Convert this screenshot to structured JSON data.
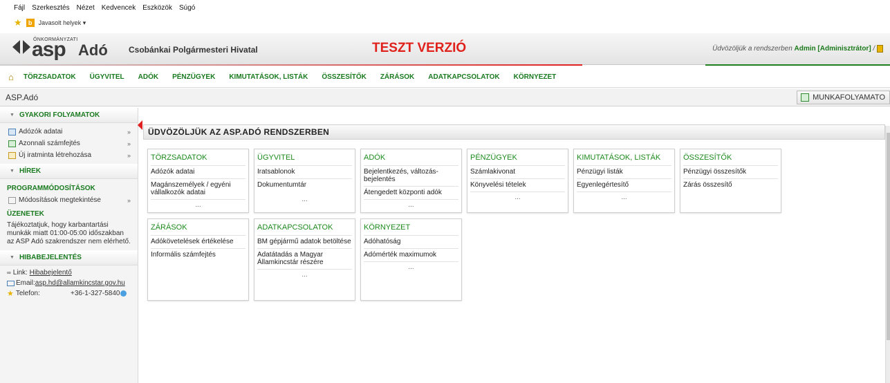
{
  "browser": {
    "menu": [
      "Fájl",
      "Szerkesztés",
      "Nézet",
      "Kedvencek",
      "Eszközök",
      "Súgó"
    ],
    "favorites_label": "Javasolt helyek ▾"
  },
  "header": {
    "logo_small": "ÖNKORMÁNYZATI",
    "logo_asp": "asp",
    "logo_ado": "Adó",
    "org_name": "Csobánkai Polgármesteri Hivatal",
    "test_banner": "TESZT VERZIÓ",
    "welcome_prefix": "Üdvözöljük a rendszerben",
    "welcome_user": "Admin [Adminisztrátor]",
    "welcome_suffix": " /"
  },
  "nav": {
    "items": [
      "TÖRZSADATOK",
      "ÜGYVITEL",
      "ADÓK",
      "PÉNZÜGYEK",
      "KIMUTATÁSOK, LISTÁK",
      "ÖSSZESÍTŐK",
      "ZÁRÁSOK",
      "ADATKAPCSOLATOK",
      "KÖRNYEZET"
    ]
  },
  "breadcrumb": "ASP.Adó",
  "workflow_button": "MUNKAFOLYAMATO",
  "sidebar": {
    "gyakori_title": "GYAKORI FOLYAMATOK",
    "gyakori_items": [
      "Adózók adatai",
      "Azonnali számfejtés",
      "Új iratminta létrehozása"
    ],
    "hirek_title": "HÍREK",
    "programmod_title": "PROGRAMMÓDOSÍTÁSOK",
    "programmod_item": "Módosítások megtekintése",
    "uzenetek_title": "ÜZENETEK",
    "uzenet_text": "Tájékoztatjuk, hogy karbantartási munkák miatt 01:00-05:00 időszakban az ASP Adó szakrendszer nem elérhető.",
    "hiba_title": "HIBABEJELENTÉS",
    "link_label": "Link:",
    "link_value": "Hibabejelentő",
    "email_label": "Email:",
    "email_value": "asp.hd@allamkincstar.gov.hu",
    "tel_label": "Telefon:",
    "tel_value": "+36-1-327-5840"
  },
  "content": {
    "title": "ÜDVÖZÖLJÜK AZ ASP.ADÓ RENDSZERBEN",
    "more": "...",
    "cards": [
      {
        "title": "TÖRZSADATOK",
        "links": [
          "Adózók adatai",
          "Magánszemélyek / egyéni vállalkozók adatai"
        ]
      },
      {
        "title": "ÜGYVITEL",
        "links": [
          "Iratsablonok",
          "Dokumentumtár"
        ]
      },
      {
        "title": "ADÓK",
        "links": [
          "Bejelentkezés, változás-bejelentés",
          "Átengedett központi adók"
        ]
      },
      {
        "title": "PÉNZÜGYEK",
        "links": [
          "Számlakivonat",
          "Könyvelési tételek"
        ]
      },
      {
        "title": "KIMUTATÁSOK, LISTÁK",
        "links": [
          "Pénzügyi listák",
          "Egyenlegértesítő"
        ]
      },
      {
        "title": "ÖSSZESÍTŐK",
        "links": [
          "Pénzügyi összesítők",
          "Zárás összesítő"
        ]
      },
      {
        "title": "ZÁRÁSOK",
        "links": [
          "Adókövetelések értékelése",
          "Informális számfejtés"
        ]
      },
      {
        "title": "ADATKAPCSOLATOK",
        "links": [
          "BM gépjármű adatok betöltése",
          "Adatátadás a Magyar Államkincstár részére"
        ]
      },
      {
        "title": "KÖRNYEZET",
        "links": [
          "Adóhatóság",
          "Adómérték maximumok"
        ]
      }
    ]
  }
}
